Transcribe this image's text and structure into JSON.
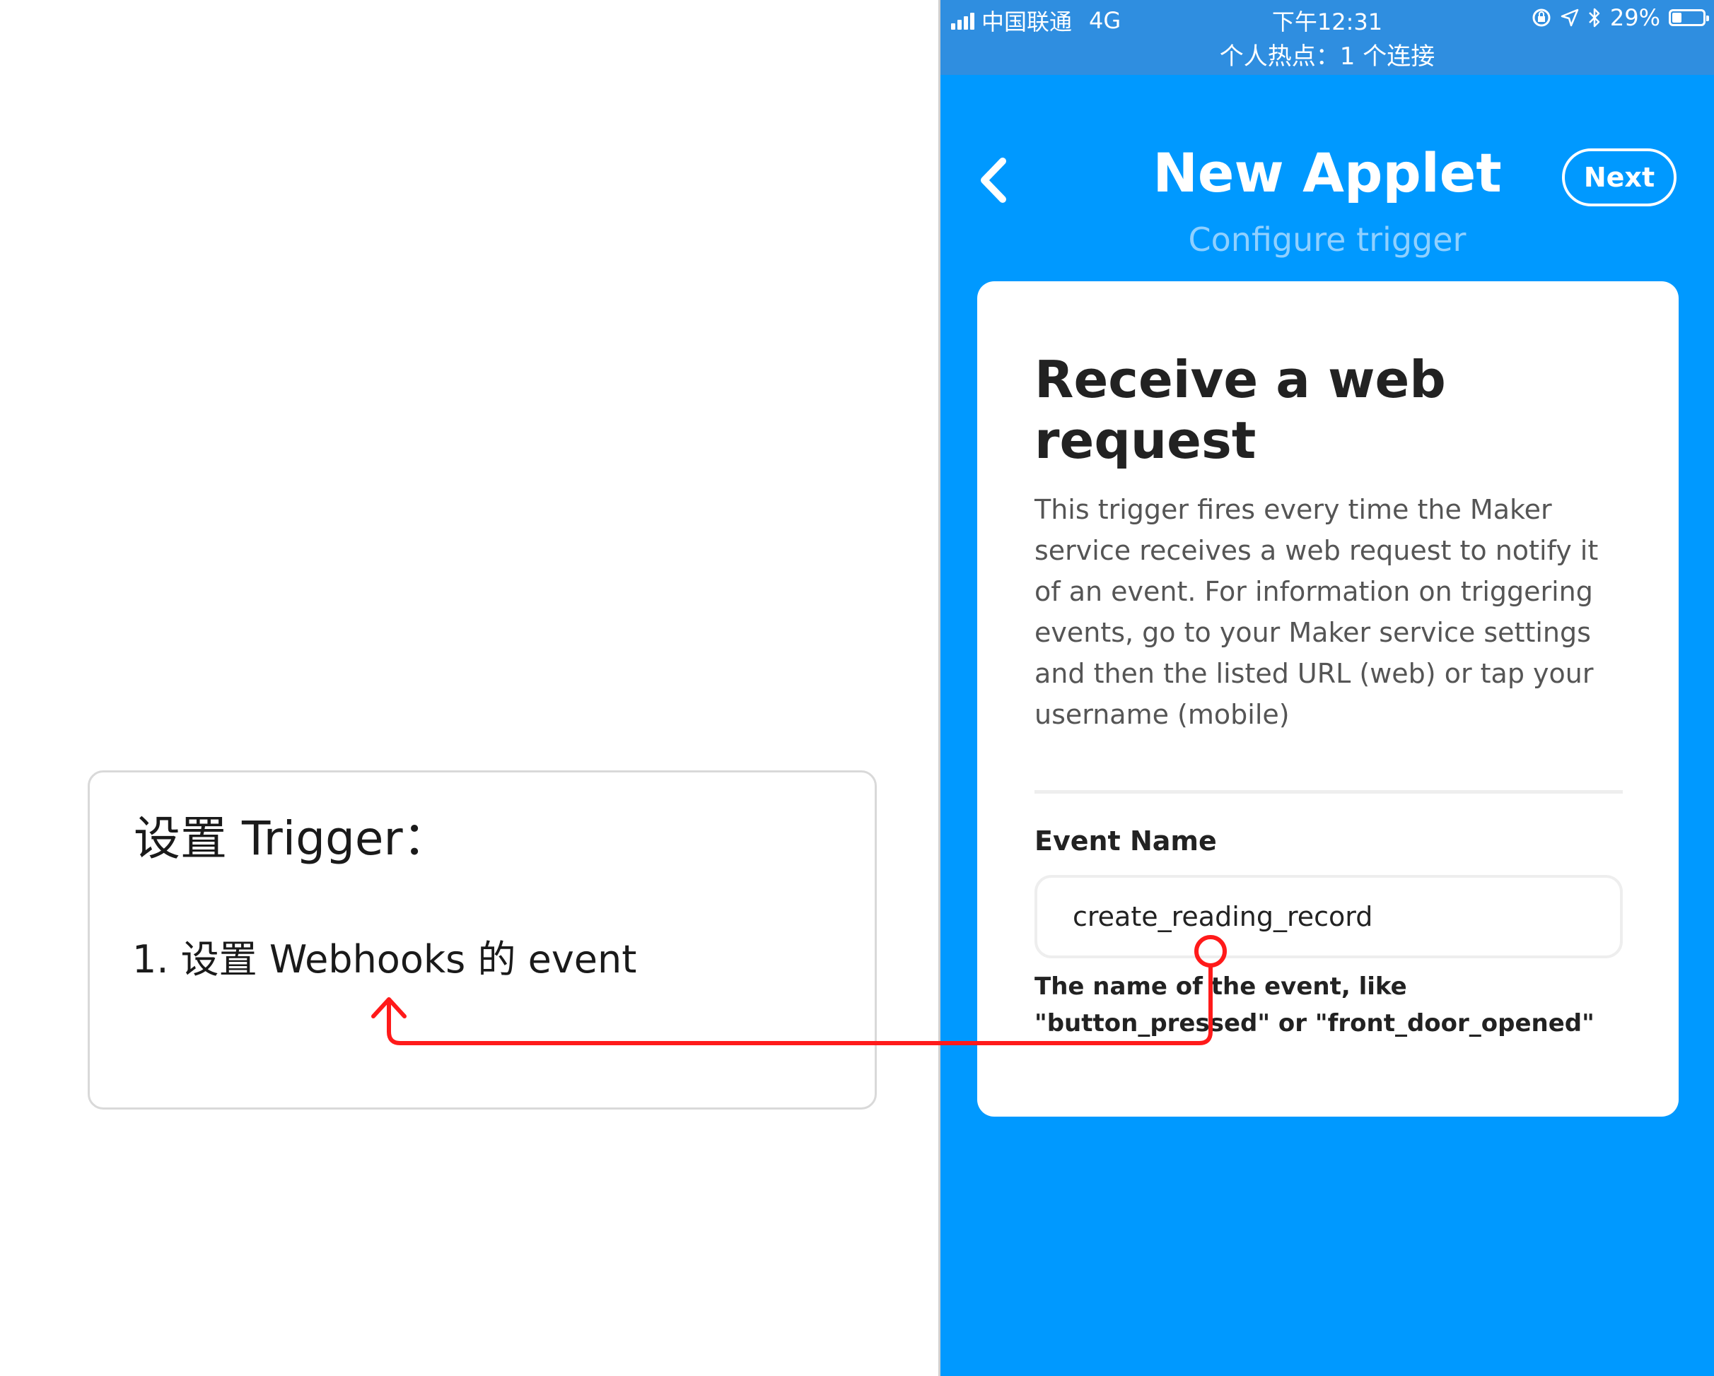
{
  "annotation": {
    "title": "设置 Trigger：",
    "step": "1. 设置 Webhooks 的 event",
    "arrow_color": "#ff1a1a"
  },
  "status_bar": {
    "carrier": "中国联通",
    "network": "4G",
    "time": "下午12:31",
    "battery": "29%",
    "battery_level": 0.29,
    "hotspot": "个人热点：1 个连接"
  },
  "nav": {
    "back_icon": "chevron-left-icon",
    "title": "New Applet",
    "next_label": "Next",
    "subtitle": "Configure trigger"
  },
  "card": {
    "title": "Receive a web request",
    "description": "This trigger fires every time the Maker service receives a web request to notify it of an event. For information on triggering events, go to your Maker service settings and then the listed URL (web) or tap your username (mobile)",
    "field": {
      "label": "Event Name",
      "value": "create_reading_record",
      "help": "The name of the event, like \"button_pressed\" or \"front_door_opened\""
    }
  },
  "colors": {
    "brand_blue": "#0099ff",
    "status_bar": "#2f8ee0",
    "subtitle": "#8fd0ff"
  }
}
